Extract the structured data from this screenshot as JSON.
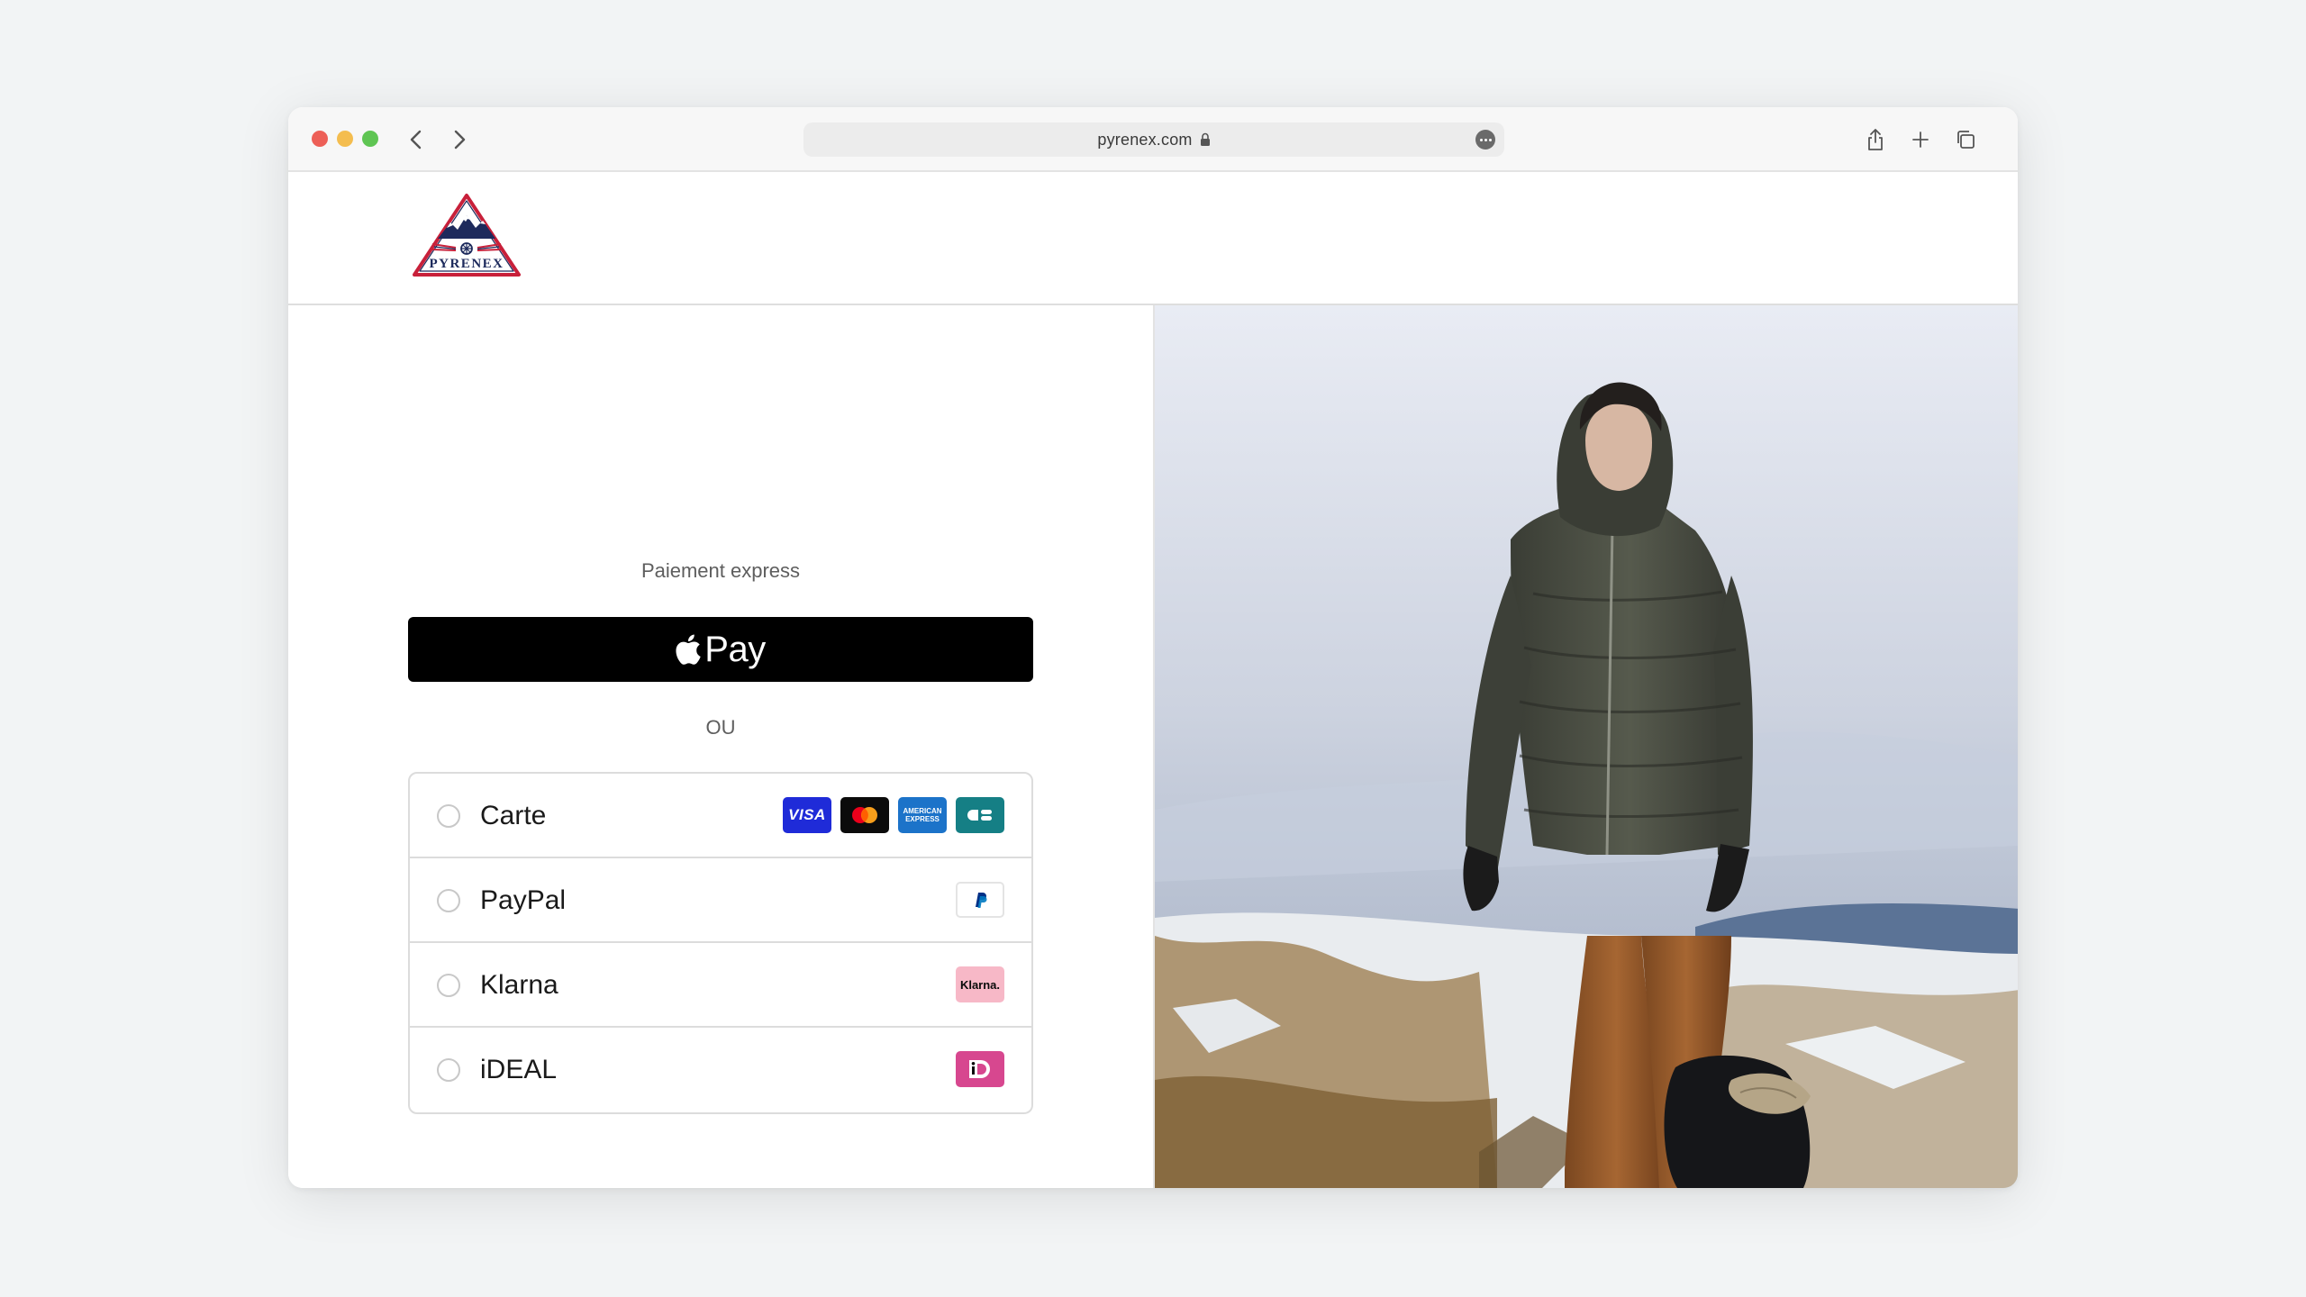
{
  "browser": {
    "url": "pyrenex.com"
  },
  "brand": {
    "name": "PYRENEX",
    "navy": "#1d2a5c",
    "red": "#c8203a"
  },
  "checkout": {
    "express_title": "Paiement express",
    "applepay_label": "Pay",
    "or_label": "OU",
    "methods": [
      {
        "label": "Carte",
        "badges": [
          "visa-icon",
          "mastercard-icon",
          "amex-icon",
          "cb-icon"
        ]
      },
      {
        "label": "PayPal",
        "badges": [
          "paypal-icon"
        ]
      },
      {
        "label": "Klarna",
        "badges": [
          "klarna-icon"
        ]
      },
      {
        "label": "iDEAL",
        "badges": [
          "ideal-icon"
        ]
      }
    ],
    "badge_text": {
      "visa": "VISA",
      "amex_top": "AMERICAN",
      "amex_bottom": "EXPRESS",
      "klarna": "Klarna."
    }
  },
  "colors": {
    "applepay_bg": "#000000",
    "visa": "#1f2bd8",
    "amex": "#1c73c9",
    "cb": "#157f85",
    "klarna": "#f7b8c7",
    "ideal": "#d7478f"
  }
}
